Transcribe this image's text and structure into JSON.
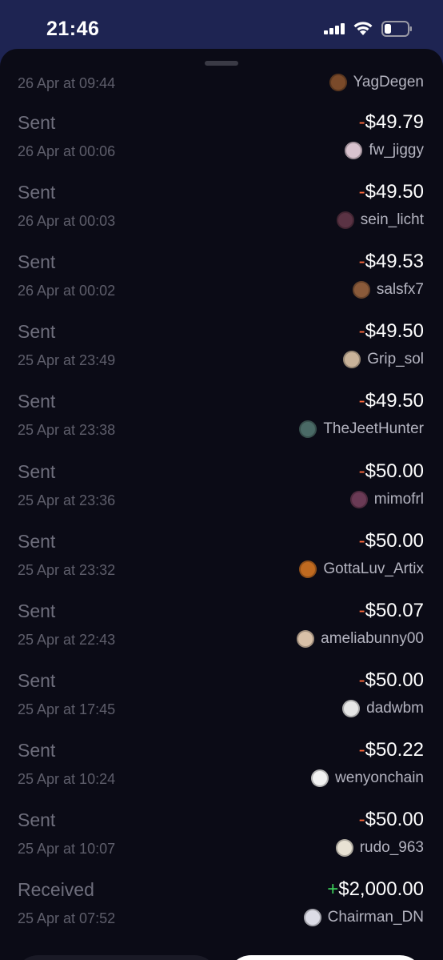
{
  "status_bar": {
    "time": "21:46"
  },
  "first_row": {
    "date": "26 Apr at 09:44",
    "user": "YagDegen",
    "avatar_color": "#7a4a2a"
  },
  "transactions": [
    {
      "type": "Sent",
      "sign": "-",
      "amount": "$49.79",
      "date": "26 Apr at 00:06",
      "user": "fw_jiggy",
      "avatar_color": "#d9c3cf"
    },
    {
      "type": "Sent",
      "sign": "-",
      "amount": "$49.50",
      "date": "26 Apr at 00:03",
      "user": "sein_licht",
      "avatar_color": "#5a3344"
    },
    {
      "type": "Sent",
      "sign": "-",
      "amount": "$49.53",
      "date": "26 Apr at 00:02",
      "user": "salsfx7",
      "avatar_color": "#8a5a3a"
    },
    {
      "type": "Sent",
      "sign": "-",
      "amount": "$49.50",
      "date": "25 Apr at 23:49",
      "user": "Grip_sol",
      "avatar_color": "#c9b39a"
    },
    {
      "type": "Sent",
      "sign": "-",
      "amount": "$49.50",
      "date": "25 Apr at 23:38",
      "user": "TheJeetHunter",
      "avatar_color": "#4a6a66"
    },
    {
      "type": "Sent",
      "sign": "-",
      "amount": "$50.00",
      "date": "25 Apr at 23:36",
      "user": "mimofrl",
      "avatar_color": "#6a3a55"
    },
    {
      "type": "Sent",
      "sign": "-",
      "amount": "$50.00",
      "date": "25 Apr at 23:32",
      "user": "GottaLuv_Artix",
      "avatar_color": "#c06a20"
    },
    {
      "type": "Sent",
      "sign": "-",
      "amount": "$50.07",
      "date": "25 Apr at 22:43",
      "user": "ameliabunny00",
      "avatar_color": "#d8c0a8"
    },
    {
      "type": "Sent",
      "sign": "-",
      "amount": "$50.00",
      "date": "25 Apr at 17:45",
      "user": "dadwbm",
      "avatar_color": "#e6e6e6"
    },
    {
      "type": "Sent",
      "sign": "-",
      "amount": "$50.22",
      "date": "25 Apr at 10:24",
      "user": "wenyonchain",
      "avatar_color": "#f2f2f2"
    },
    {
      "type": "Sent",
      "sign": "-",
      "amount": "$50.00",
      "date": "25 Apr at 10:07",
      "user": "rudo_963",
      "avatar_color": "#e8e2d4"
    },
    {
      "type": "Received",
      "sign": "+",
      "amount": "$2,000.00",
      "date": "25 Apr at 07:52",
      "user": "Chairman_DN",
      "avatar_color": "#dcdce6"
    }
  ],
  "colors": {
    "negative": "#ff6a3d",
    "positive": "#3ccf5a",
    "background": "#0b0b16"
  }
}
